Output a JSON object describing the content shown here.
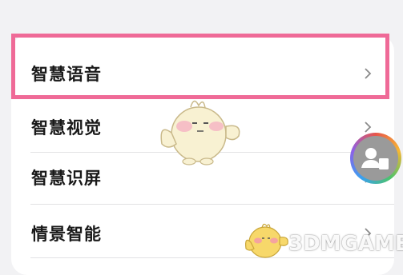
{
  "settings": {
    "items": [
      {
        "label": "智慧语音"
      },
      {
        "label": "智慧视觉"
      },
      {
        "label": "智慧识屏"
      },
      {
        "label": "情景智能"
      }
    ]
  },
  "watermark": {
    "text": "3DMGAME"
  },
  "colors": {
    "highlight_border": "#ef6a97",
    "background": "#f2f2f4",
    "card": "#ffffff"
  }
}
